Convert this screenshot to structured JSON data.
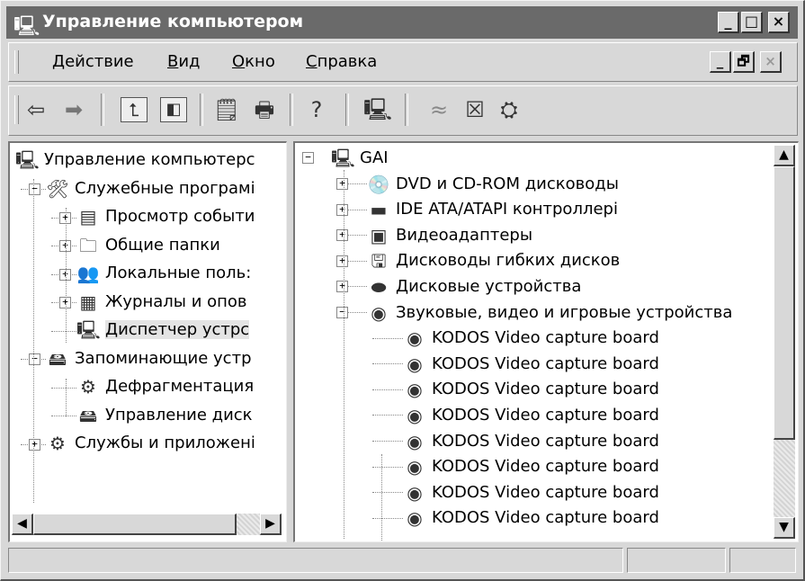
{
  "window": {
    "title": "Управление компьютером",
    "controls": [
      "_",
      "□",
      "×"
    ]
  },
  "menu": {
    "items": [
      "Действие",
      "Вид",
      "Окно",
      "Справка"
    ],
    "mdi_controls": [
      "_",
      "🗗",
      "×"
    ]
  },
  "toolbar": {
    "buttons": [
      "back-icon",
      "forward-icon",
      "up-folder-icon",
      "show-tree-icon",
      "properties-icon",
      "print-icon",
      "help-icon",
      "computer-icon",
      "disable-icon",
      "uninstall-icon",
      "scan-hardware-icon"
    ]
  },
  "left_tree": [
    {
      "label": "Управление компьютерс",
      "icon": "computer-icon",
      "level": 0,
      "expander": null
    },
    {
      "label": "Служебные програмі",
      "icon": "tools-icon",
      "level": 1,
      "expander": "-"
    },
    {
      "label": "Просмотр событи",
      "icon": "event-viewer-icon",
      "level": 2,
      "expander": "+"
    },
    {
      "label": "Общие папки",
      "icon": "shared-folder-icon",
      "level": 2,
      "expander": "+"
    },
    {
      "label": "Локальные поль:",
      "icon": "users-icon",
      "level": 2,
      "expander": "+"
    },
    {
      "label": "Журналы и опов",
      "icon": "logs-icon",
      "level": 2,
      "expander": "+"
    },
    {
      "label": "Диспетчер устрс",
      "icon": "device-manager-icon",
      "level": 2,
      "expander": null,
      "selected": true
    },
    {
      "label": "Запоминающие устр",
      "icon": "storage-icon",
      "level": 1,
      "expander": "-"
    },
    {
      "label": "Дефрагментация",
      "icon": "defrag-icon",
      "level": 2,
      "expander": null
    },
    {
      "label": "Управление диск",
      "icon": "disk-management-icon",
      "level": 2,
      "expander": null
    },
    {
      "label": "Службы и приложені",
      "icon": "services-icon",
      "level": 1,
      "expander": "+"
    }
  ],
  "right_tree": [
    {
      "label": "GAI",
      "icon": "computer-icon",
      "level": 0,
      "expander": "-"
    },
    {
      "label": "DVD и CD-ROM дисководы",
      "icon": "cdrom-icon",
      "level": 1,
      "expander": "+"
    },
    {
      "label": "IDE ATA/ATAPI контроллері",
      "icon": "ide-controller-icon",
      "level": 1,
      "expander": "+"
    },
    {
      "label": "Видеоадаптеры",
      "icon": "display-adapter-icon",
      "level": 1,
      "expander": "+"
    },
    {
      "label": "Дисководы гибких дисков",
      "icon": "floppy-icon",
      "level": 1,
      "expander": "+"
    },
    {
      "label": "Дисковые устройства",
      "icon": "disk-drive-icon",
      "level": 1,
      "expander": "+"
    },
    {
      "label": "Звуковые, видео и игровые устройства",
      "icon": "sound-icon",
      "level": 1,
      "expander": "-"
    },
    {
      "label": "KODOS Video capture board",
      "icon": "sound-icon",
      "level": 2,
      "expander": null
    },
    {
      "label": "KODOS Video capture board",
      "icon": "sound-icon",
      "level": 2,
      "expander": null
    },
    {
      "label": "KODOS Video capture board",
      "icon": "sound-icon",
      "level": 2,
      "expander": null
    },
    {
      "label": "KODOS Video capture board",
      "icon": "sound-icon",
      "level": 2,
      "expander": null
    },
    {
      "label": "KODOS Video capture board",
      "icon": "sound-icon",
      "level": 2,
      "expander": null
    },
    {
      "label": "KODOS Video capture board",
      "icon": "sound-icon",
      "level": 2,
      "expander": null
    },
    {
      "label": "KODOS Video capture board",
      "icon": "sound-icon",
      "level": 2,
      "expander": null
    },
    {
      "label": "KODOS Video capture board",
      "icon": "sound-icon",
      "level": 2,
      "expander": null
    }
  ],
  "status": {
    "panels": [
      "",
      "",
      ""
    ]
  }
}
